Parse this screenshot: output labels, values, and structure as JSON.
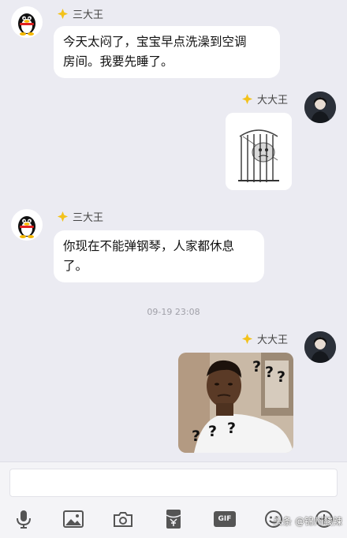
{
  "conversation": {
    "timestamp": "09-19 23:08",
    "messages": [
      {
        "sender": "三大王",
        "side": "left",
        "type": "text",
        "text": "今天太闷了，宝宝早点洗澡到空调房间。我要先睡了。",
        "lines": [
          "今天太闷了，宝宝早点洗澡到空调",
          "房间。我要先睡了。"
        ]
      },
      {
        "sender": "大大王",
        "side": "right",
        "type": "sticker",
        "sticker": "caged-cartoon-sticker"
      },
      {
        "sender": "三大王",
        "side": "left",
        "type": "text",
        "text": "你现在不能弹钢琴，人家都休息了。",
        "lines": [
          "你现在不能弹钢琴，人家都休息",
          "了。"
        ]
      },
      {
        "sender": "大大王",
        "side": "right",
        "type": "sticker",
        "sticker": "confused-man-meme",
        "marks": [
          "?",
          "?",
          "?",
          "?",
          "?",
          "?"
        ]
      }
    ]
  },
  "input_bar": {
    "placeholder": "",
    "tools": [
      "microphone-icon",
      "image-icon",
      "camera-icon",
      "red-packet-icon",
      "gif-icon",
      "emoji-icon",
      "plus-icon"
    ],
    "gif_label": "GIF"
  },
  "watermark": "头条 @锦州酸辣",
  "colors": {
    "background": "#ebebf2",
    "bubble": "#ffffff",
    "badge": "#f3c21b"
  }
}
